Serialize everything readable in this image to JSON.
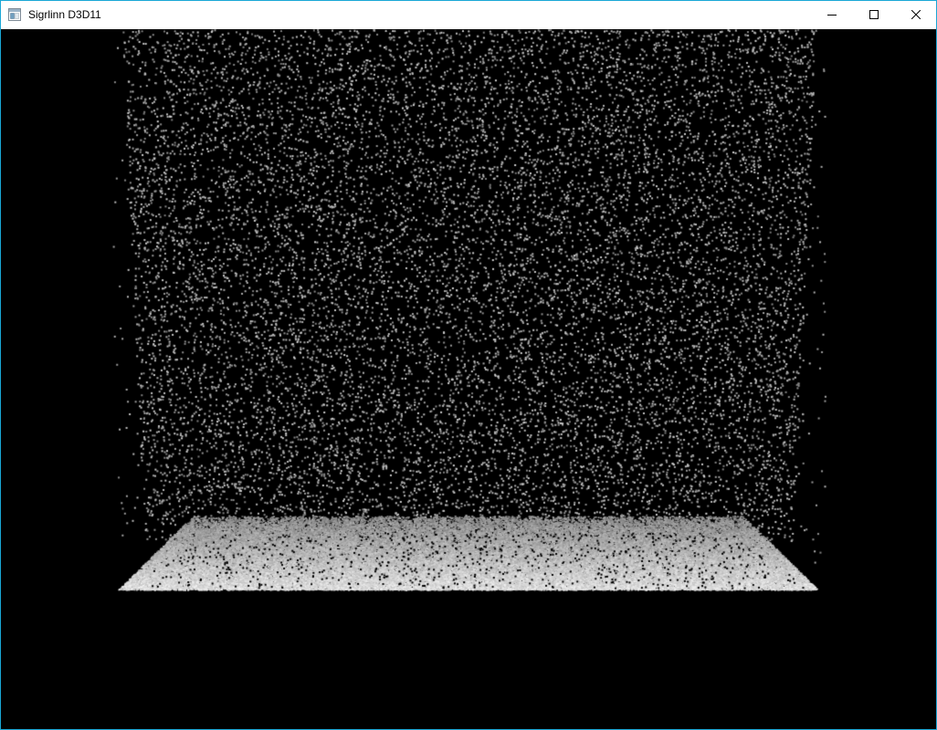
{
  "window": {
    "title": "Sigrlinn D3D11",
    "icons": {
      "app": "app-window-icon",
      "minimize": "minimize-icon",
      "maximize": "maximize-icon",
      "close": "close-icon"
    },
    "colors": {
      "frame_border": "#1aa7d6",
      "titlebar_bg": "#ffffff",
      "viewport_bg": "#000000",
      "particle": "#b4b4b4"
    }
  }
}
